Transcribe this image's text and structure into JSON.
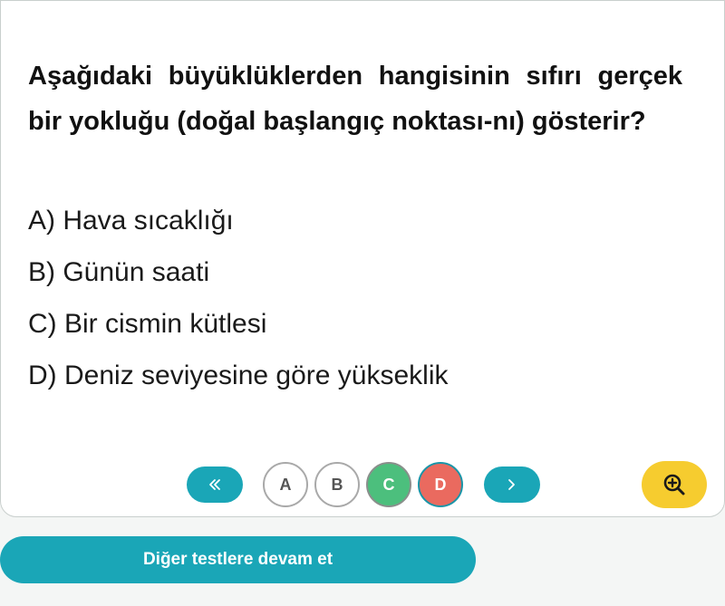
{
  "question": {
    "text": "Aşağıdaki büyüklüklerden hangisinin sıfırı gerçek bir yokluğu (doğal başlangıç noktası-nı) gösterir?"
  },
  "options": [
    {
      "text": "A) Hava sıcaklığı"
    },
    {
      "text": "B) Günün saati"
    },
    {
      "text": "C) Bir cismin kütlesi"
    },
    {
      "text": "D) Deniz seviyesine göre yükseklik"
    }
  ],
  "answer_bar": {
    "prev_icon": "double-chevron-left-icon",
    "next_icon": "chevron-right-icon",
    "choices": [
      {
        "label": "A",
        "state": "default"
      },
      {
        "label": "B",
        "state": "default"
      },
      {
        "label": "C",
        "state": "correct"
      },
      {
        "label": "D",
        "state": "wrong"
      }
    ],
    "zoom_icon": "zoom-in-icon"
  },
  "continue_button": {
    "label": "Diğer testlere devam et"
  },
  "colors": {
    "accent": "#1aa6b7",
    "correct": "#4cbf7d",
    "wrong": "#ea6a5f",
    "zoom": "#f6cc2f"
  }
}
